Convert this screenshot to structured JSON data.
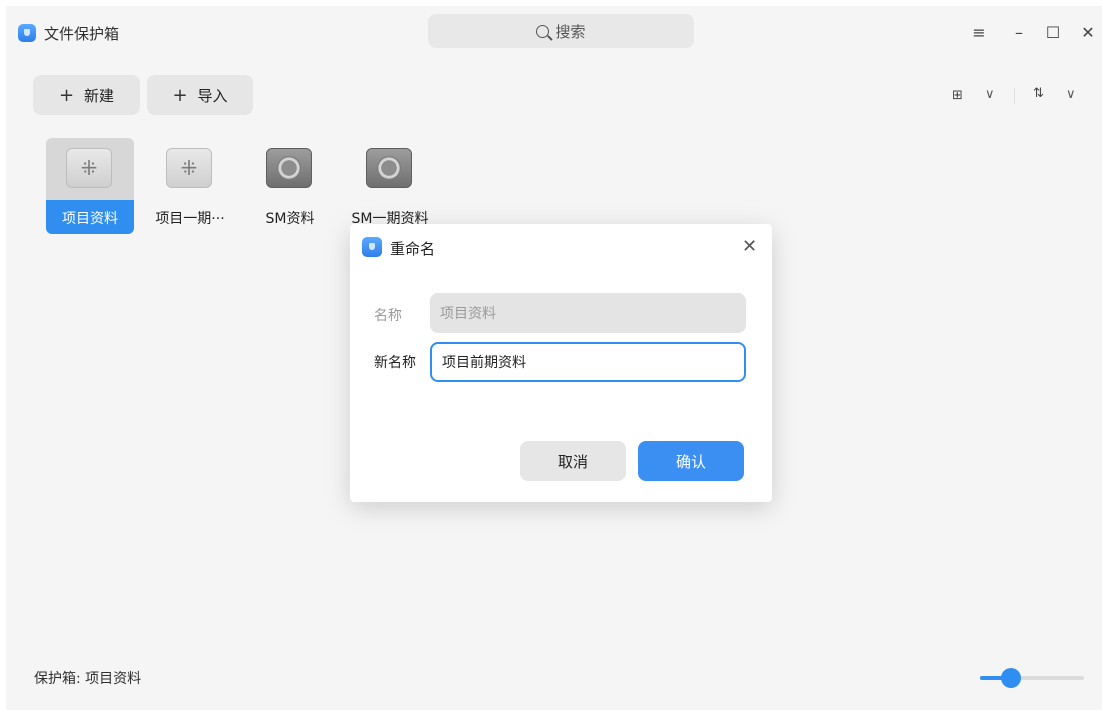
{
  "app": {
    "title": "文件保护箱"
  },
  "search": {
    "label": "搜索"
  },
  "window_controls": {
    "menu": "≡",
    "minimize": "–",
    "maximize": "☐",
    "close": "✕"
  },
  "toolbar": {
    "new_label": "新建",
    "import_label": "导入",
    "view_mode_icon": "grid-icon",
    "sort_icon": "sort-icon"
  },
  "vaults": [
    {
      "name": "项目资料",
      "state": "locked",
      "selected": true
    },
    {
      "name": "项目一期···",
      "state": "locked",
      "selected": false
    },
    {
      "name": "SM资料",
      "state": "safe",
      "selected": false
    },
    {
      "name": "SM一期资料",
      "state": "safe",
      "selected": false
    }
  ],
  "status": {
    "text": "保护箱: 项目资料"
  },
  "zoom_slider": {
    "level": 0.3
  },
  "dialog": {
    "title": "重命名",
    "old_name_label": "名称",
    "old_name_value": "项目资料",
    "new_name_label": "新名称",
    "new_name_value": "项目前期资料",
    "cancel_label": "取消",
    "confirm_label": "确认"
  },
  "colors": {
    "accent": "#2f8ef0",
    "background": "#f5f5f5",
    "dialog_bg": "#ffffff"
  }
}
